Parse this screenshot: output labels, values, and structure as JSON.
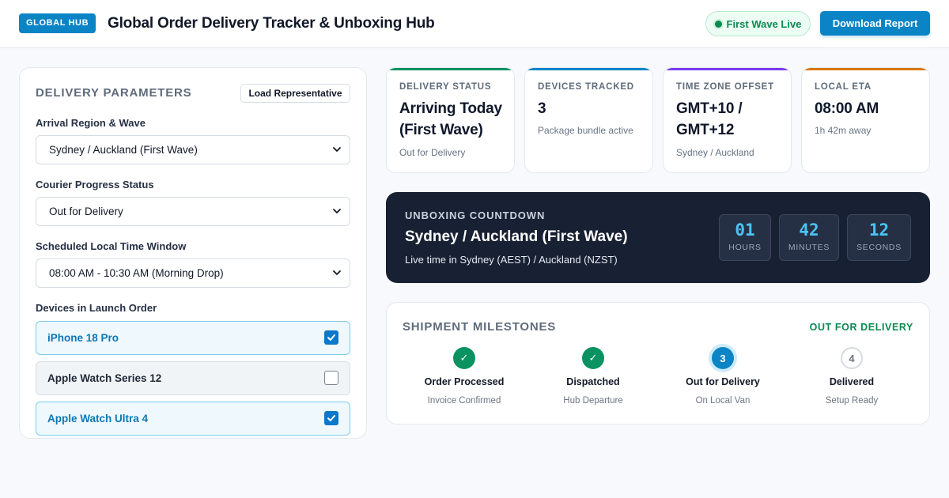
{
  "header": {
    "badge": "GLOBAL HUB",
    "title": "Global Order Delivery Tracker & Unboxing Hub",
    "live_status": "First Wave Live",
    "download_label": "Download Report"
  },
  "params": {
    "title": "DELIVERY PARAMETERS",
    "load_label": "Load Representative",
    "region_label": "Arrival Region & Wave",
    "region_value": "Sydney / Auckland (First Wave)",
    "status_label": "Courier Progress Status",
    "status_value": "Out for Delivery",
    "window_label": "Scheduled Local Time Window",
    "window_value": "08:00 AM - 10:30 AM (Morning Drop)",
    "devices_label": "Devices in Launch Order",
    "devices": [
      {
        "name": "iPhone 18 Pro",
        "checked": true
      },
      {
        "name": "Apple Watch Series 12",
        "checked": false
      },
      {
        "name": "Apple Watch Ultra 4",
        "checked": true
      }
    ]
  },
  "stats": [
    {
      "label": "DELIVERY STATUS",
      "value": "Arriving Today (First Wave)",
      "sub": "Out for Delivery",
      "accent": "#0a9260"
    },
    {
      "label": "DEVICES TRACKED",
      "value": "3",
      "sub": "Package bundle active",
      "accent": "#0b84c6"
    },
    {
      "label": "TIME ZONE OFFSET",
      "value": "GMT+10 / GMT+12",
      "sub": "Sydney / Auckland",
      "accent": "#7c3aed"
    },
    {
      "label": "LOCAL ETA",
      "value": "08:00 AM",
      "sub": "1h 42m away",
      "accent": "#d97706"
    }
  ],
  "countdown": {
    "label": "UNBOXING COUNTDOWN",
    "title": "Sydney / Auckland (First Wave)",
    "subtitle": "Live time in Sydney (AEST) / Auckland (NZST)",
    "hours": "01",
    "hours_unit": "HOURS",
    "minutes": "42",
    "minutes_unit": "MINUTES",
    "seconds": "12",
    "seconds_unit": "SECONDS"
  },
  "milestones": {
    "title": "SHIPMENT MILESTONES",
    "status": "OUT FOR DELIVERY",
    "steps": [
      {
        "marker": "✓",
        "name": "Order Processed",
        "sub": "Invoice Confirmed",
        "state": "done"
      },
      {
        "marker": "✓",
        "name": "Dispatched",
        "sub": "Hub Departure",
        "state": "done"
      },
      {
        "marker": "3",
        "name": "Out for Delivery",
        "sub": "On Local Van",
        "state": "current"
      },
      {
        "marker": "4",
        "name": "Delivered",
        "sub": "Setup Ready",
        "state": "pending"
      }
    ]
  },
  "colors": {
    "brand": "#0b84c6",
    "success": "#0a8a50",
    "dark_panel": "#182033",
    "countdown_digits": "#4cc3f5"
  }
}
